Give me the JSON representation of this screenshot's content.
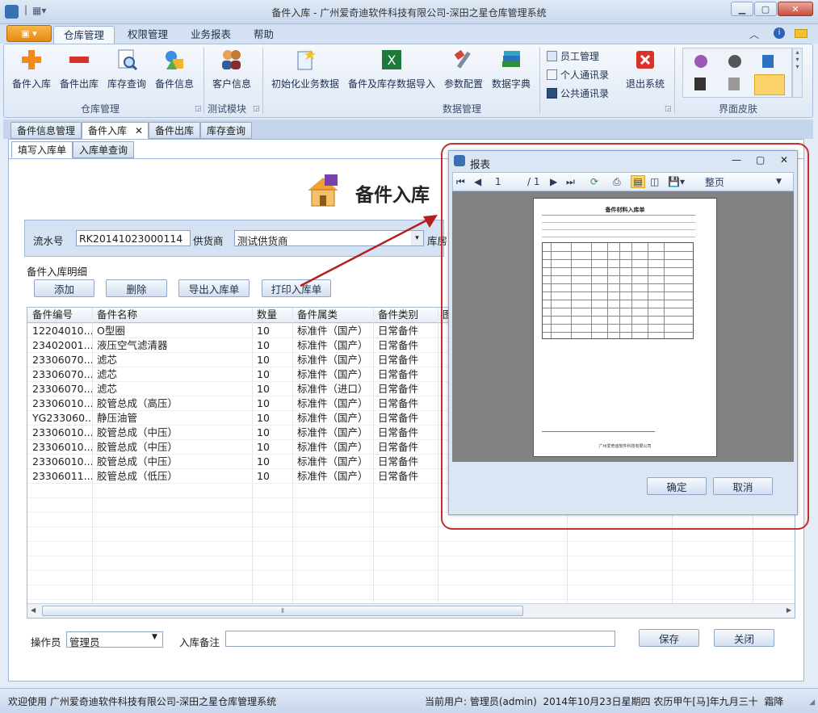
{
  "window": {
    "title": "备件入库 - 广州爱奇迪软件科技有限公司-深田之星仓库管理系统"
  },
  "ribbon_tabs": [
    "仓库管理",
    "权限管理",
    "业务报表",
    "帮助"
  ],
  "ribbon": {
    "warehouse_buttons": [
      "备件入库",
      "备件出库",
      "库存查询",
      "备件信息"
    ],
    "warehouse_group": "仓库管理",
    "test_buttons": [
      "客户信息"
    ],
    "test_group": "测试模块",
    "data_buttons": [
      "初始化业务数据",
      "备件及库存数据导入",
      "参数配置",
      "数据字典"
    ],
    "small_buttons": [
      "员工管理",
      "个人通讯录",
      "公共通讯录"
    ],
    "exit_button": "退出系统",
    "data_group": "数据管理",
    "skin_group": "界面皮肤"
  },
  "doc_tabs": [
    "备件信息管理",
    "备件入库",
    "备件出库",
    "库存查询"
  ],
  "sub_tabs": [
    "填写入库单",
    "入库单查询"
  ],
  "page_title": "备件入库",
  "form": {
    "serial_label": "流水号",
    "serial_value": "RK20141023000114",
    "supplier_label": "供货商",
    "supplier_value": "测试供货商",
    "warehouse_label": "库房"
  },
  "detail_group": "备件入库明细",
  "actions": [
    "添加",
    "删除",
    "导出入库单",
    "打印入库单"
  ],
  "table": {
    "columns": [
      "备件编号",
      "备件名称",
      "数量",
      "备件属类",
      "备件类别",
      "图"
    ],
    "rows": [
      [
        "12204010...",
        "O型圈",
        "10",
        "标准件（国产）",
        "日常备件"
      ],
      [
        "23402001...",
        "液压空气滤清器",
        "10",
        "标准件（国产）",
        "日常备件"
      ],
      [
        "23306070...",
        "滤芯",
        "10",
        "标准件（国产）",
        "日常备件"
      ],
      [
        "23306070...",
        "滤芯",
        "10",
        "标准件（国产）",
        "日常备件"
      ],
      [
        "23306070...",
        "滤芯",
        "10",
        "标准件（进口）",
        "日常备件"
      ],
      [
        "23306010...",
        "胶管总成（高压）",
        "10",
        "标准件（国产）",
        "日常备件"
      ],
      [
        "YG233060...",
        "静压油管",
        "10",
        "标准件（国产）",
        "日常备件"
      ],
      [
        "23306010...",
        "胶管总成（中压）",
        "10",
        "标准件（国产）",
        "日常备件"
      ],
      [
        "23306010...",
        "胶管总成（中压）",
        "10",
        "标准件（国产）",
        "日常备件"
      ],
      [
        "23306010...",
        "胶管总成（中压）",
        "10",
        "标准件（国产）",
        "日常备件"
      ],
      [
        "23306011...",
        "胶管总成（低压）",
        "10",
        "标准件（国产）",
        "日常备件"
      ]
    ]
  },
  "bottom": {
    "operator_label": "操作员",
    "operator_value": "管理员",
    "remark_label": "入库备注",
    "save_button": "保存",
    "close_button": "关闭"
  },
  "status": {
    "left": "欢迎使用 广州爱奇迪软件科技有限公司-深田之星仓库管理系统",
    "right": "当前用户: 管理员(admin)  2014年10月23日星期四 农历甲午[马]年九月三十  霜降"
  },
  "report_dialog": {
    "title": "报表",
    "page_current": "1",
    "page_total": "/ 1",
    "zoom": "整页",
    "ok_button": "确定",
    "cancel_button": "取消",
    "paper_title": "备件材料入库单",
    "paper_footer": "广州爱奇迪软件科技有限公司"
  },
  "colors": {
    "accent": "#e58a12",
    "highlight": "#c62d2d",
    "ribbon_bg": "#dfe8f5"
  }
}
